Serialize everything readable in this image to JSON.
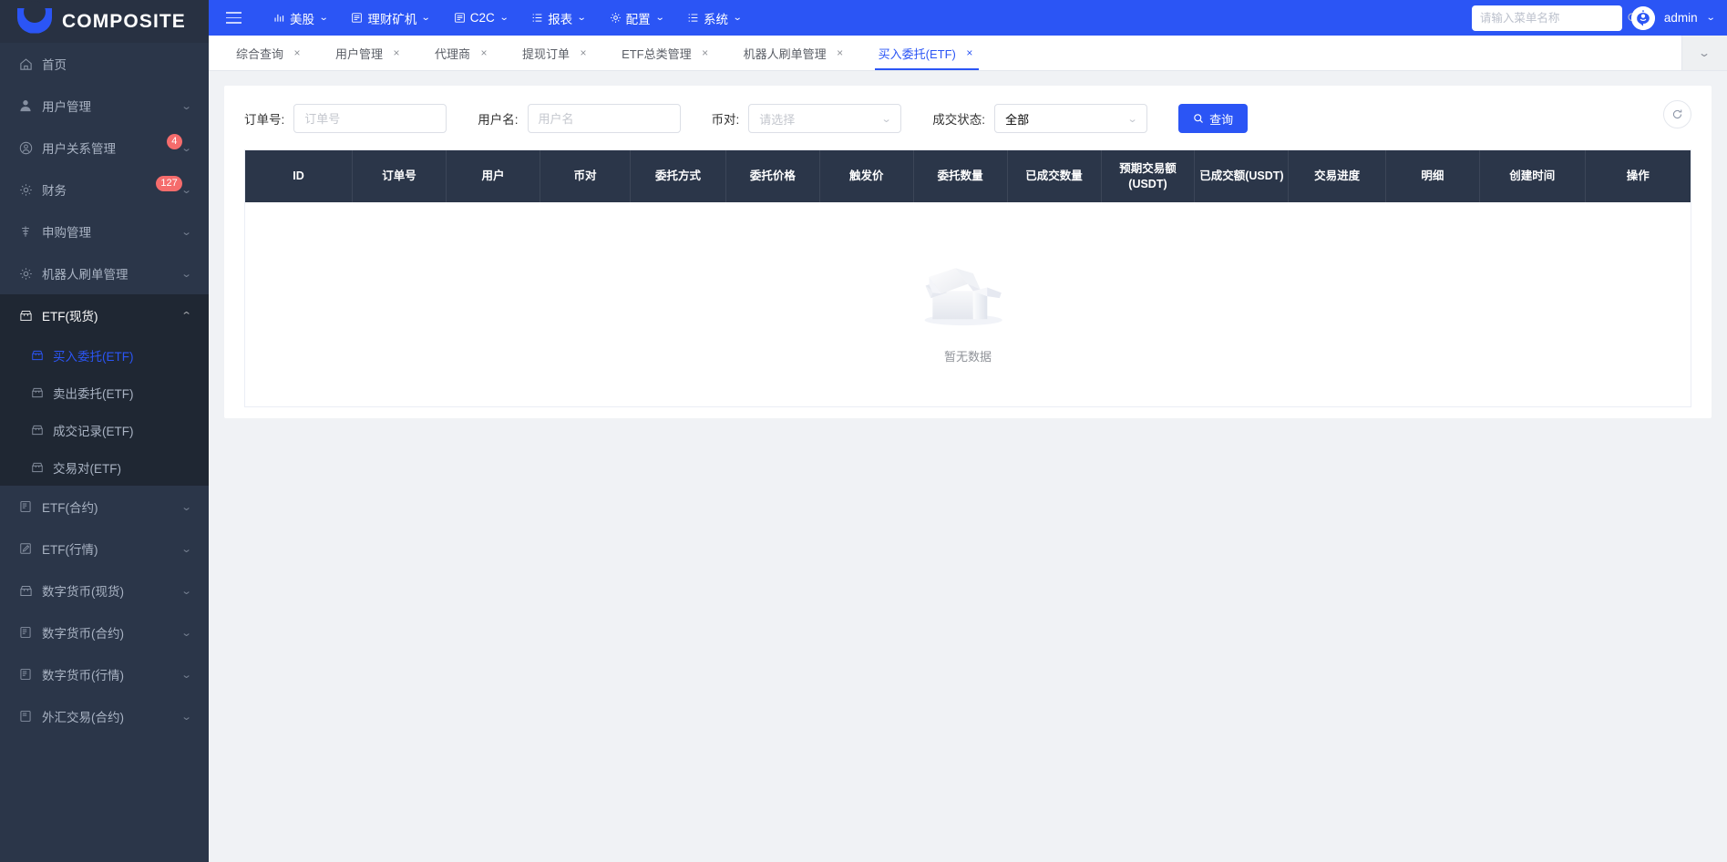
{
  "brand": {
    "title": "COMPOSITE",
    "logo_icon": "crescent-logo"
  },
  "sidebar": {
    "items": [
      {
        "label": "首页",
        "icon": "home-icon",
        "arrow": "",
        "badge": ""
      },
      {
        "label": "用户管理",
        "icon": "user-icon",
        "arrow": "⌄",
        "badge": ""
      },
      {
        "label": "用户关系管理",
        "icon": "user-circle-icon",
        "arrow": "⌄",
        "badge": "4"
      },
      {
        "label": "财务",
        "icon": "gear-icon",
        "arrow": "⌄",
        "badge": "127"
      },
      {
        "label": "申购管理",
        "icon": "bank-icon",
        "arrow": "⌄",
        "badge": ""
      },
      {
        "label": "机器人刷单管理",
        "icon": "gear-icon",
        "arrow": "⌄",
        "badge": ""
      },
      {
        "label": "ETF(现货)",
        "icon": "shop-icon",
        "arrow": "⌃",
        "badge": "",
        "expanded": true
      },
      {
        "label": "ETF(合约)",
        "icon": "sql-icon",
        "arrow": "⌄",
        "badge": ""
      },
      {
        "label": "ETF(行情)",
        "icon": "edit-icon",
        "arrow": "⌄",
        "badge": ""
      },
      {
        "label": "数字货币(现货)",
        "icon": "shop-icon",
        "arrow": "⌄",
        "badge": ""
      },
      {
        "label": "数字货币(合约)",
        "icon": "sql-icon",
        "arrow": "⌄",
        "badge": ""
      },
      {
        "label": "数字货币(行情)",
        "icon": "sql-icon",
        "arrow": "⌄",
        "badge": ""
      },
      {
        "label": "外汇交易(合约)",
        "icon": "sql-icon",
        "arrow": "⌄",
        "badge": ""
      }
    ],
    "submenu": [
      {
        "label": "买入委托(ETF)",
        "icon": "shop-icon",
        "active": true
      },
      {
        "label": "卖出委托(ETF)",
        "icon": "shop-icon",
        "active": false
      },
      {
        "label": "成交记录(ETF)",
        "icon": "shop-icon",
        "active": false
      },
      {
        "label": "交易对(ETF)",
        "icon": "shop-icon",
        "active": false
      }
    ]
  },
  "topnav": {
    "hamburger_icon": "hamburger-icon",
    "items": [
      {
        "label": "美股",
        "icon": "chart-bar-icon",
        "caret": "⌄"
      },
      {
        "label": "理财矿机",
        "icon": "list-icon",
        "caret": "⌄"
      },
      {
        "label": "C2C",
        "icon": "list-icon",
        "caret": "⌄"
      },
      {
        "label": "报表",
        "icon": "menu-list-icon",
        "caret": "⌄"
      },
      {
        "label": "配置",
        "icon": "gear-icon",
        "caret": "⌄"
      },
      {
        "label": "系统",
        "icon": "menu-list-icon",
        "caret": "⌄"
      }
    ],
    "search": {
      "placeholder": "请输入菜单名称",
      "value": "",
      "icon": "search-icon"
    },
    "user": {
      "name": "admin",
      "caret": "⌄",
      "avatar_icon": "robot-avatar-icon"
    }
  },
  "tabs": {
    "items": [
      {
        "label": "综合查询",
        "close": "×",
        "active": false
      },
      {
        "label": "用户管理",
        "close": "×",
        "active": false
      },
      {
        "label": "代理商",
        "close": "×",
        "active": false
      },
      {
        "label": "提现订单",
        "close": "×",
        "active": false
      },
      {
        "label": "ETF总类管理",
        "close": "×",
        "active": false
      },
      {
        "label": "机器人刷单管理",
        "close": "×",
        "active": false
      },
      {
        "label": "买入委托(ETF)",
        "close": "×",
        "active": true
      }
    ],
    "more_icon": "chevron-down-icon",
    "more_caret": "⌄"
  },
  "filters": {
    "order_no": {
      "label": "订单号:",
      "placeholder": "订单号",
      "value": ""
    },
    "username": {
      "label": "用户名:",
      "placeholder": "用户名",
      "value": ""
    },
    "pair": {
      "label": "币对:",
      "placeholder": "请选择",
      "value": "",
      "caret": "⌄"
    },
    "status": {
      "label": "成交状态:",
      "value": "全部",
      "caret": "⌄"
    },
    "query_button": {
      "label": "查询",
      "icon": "search-icon"
    },
    "refresh_button": {
      "icon": "refresh-icon"
    }
  },
  "table": {
    "columns": [
      "ID",
      "订单号",
      "用户",
      "币对",
      "委托方式",
      "委托价格",
      "触发价",
      "委托数量",
      "已成交数量",
      "预期交易额(USDT)",
      "已成交额(USDT)",
      "交易进度",
      "明细",
      "创建时间",
      "操作"
    ],
    "rows": [],
    "empty_text": "暂无数据",
    "empty_icon": "empty-box-icon"
  },
  "colors": {
    "accent": "#2b55f5",
    "sidebar_bg": "#2b3649",
    "submenu_bg": "#1f2733",
    "badge": "#f56c6c",
    "table_header_bg": "#2b3649"
  }
}
